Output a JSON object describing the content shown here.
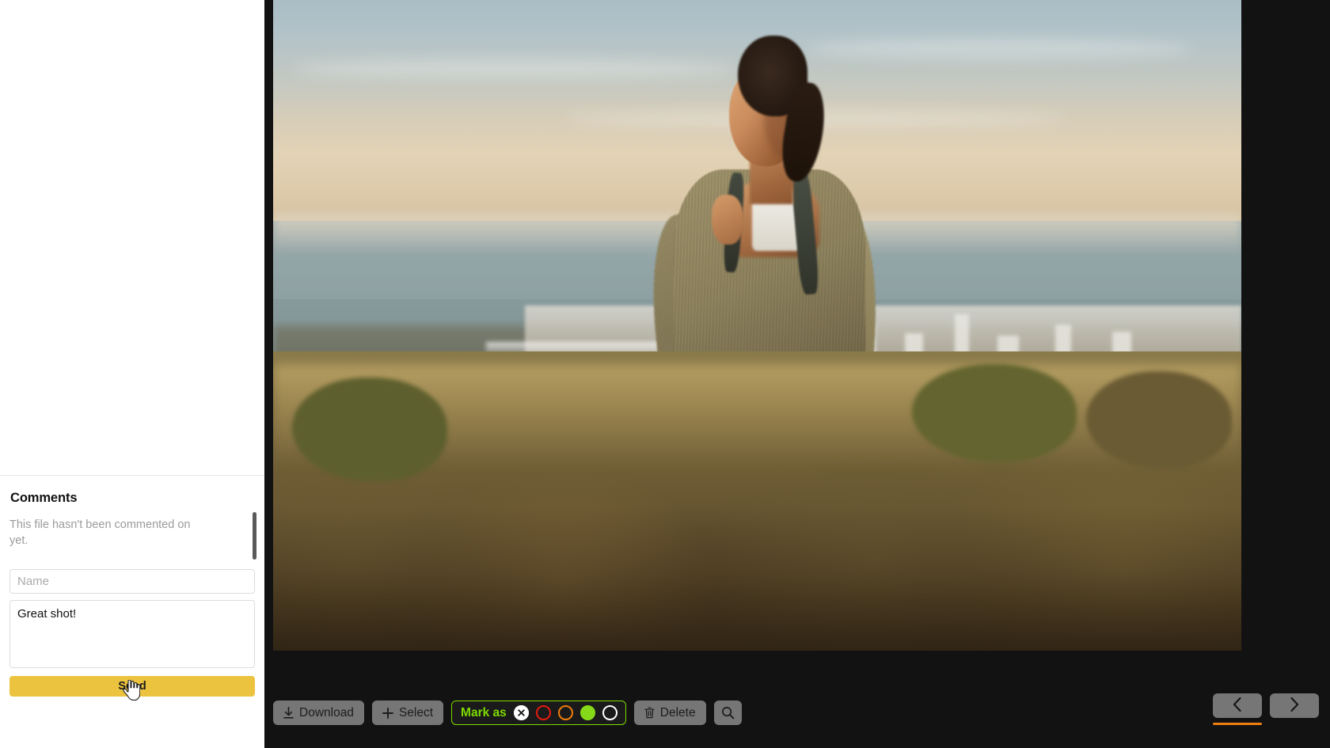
{
  "comments": {
    "title": "Comments",
    "empty_text": "This file hasn't been commented on yet.",
    "name_placeholder": "Name",
    "name_value": "",
    "comment_value": "Great shot!",
    "comment_placeholder": "",
    "send_label": "Send",
    "send_color": "#ecc33f"
  },
  "toolbar": {
    "download_label": "Download",
    "download_icon": "download-arrow-icon",
    "select_label": "Select",
    "select_icon": "plus-icon",
    "mark_as_label": "Mark as",
    "mark_as_accent": "#7ddb00",
    "markers": [
      {
        "name": "clear-marker",
        "style": "clear",
        "color": "#ffffff",
        "glyph": "x"
      },
      {
        "name": "red-marker",
        "style": "ring",
        "color": "#e51b0e"
      },
      {
        "name": "orange-marker",
        "style": "ring",
        "color": "#ef7d0b"
      },
      {
        "name": "green-marker",
        "style": "solid",
        "color": "#86d918"
      },
      {
        "name": "white-marker",
        "style": "ring",
        "color": "#ffffff"
      }
    ],
    "delete_label": "Delete",
    "delete_icon": "trash-icon",
    "zoom_icon": "magnifier-icon",
    "prev_icon": "chevron-left-icon",
    "next_icon": "chevron-right-icon",
    "active_underline_color": "#ee7d10"
  },
  "viewer": {
    "photo_alt": "Woman with backpack hiking on a coastal hillside at sunset"
  }
}
